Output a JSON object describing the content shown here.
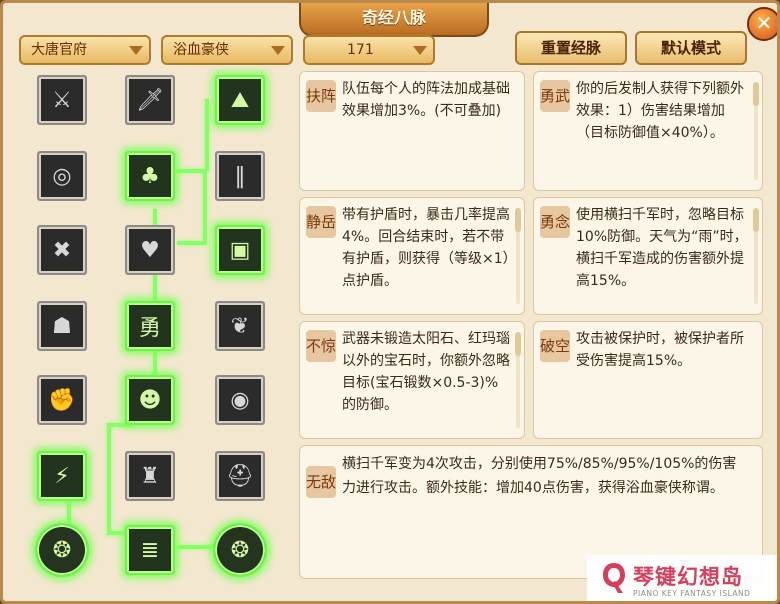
{
  "window": {
    "title": "奇经八脉",
    "close_glyph": "✕"
  },
  "toolbar": {
    "dropdown_sect": "大唐官府",
    "dropdown_school": "浴血豪侠",
    "dropdown_level": "171",
    "reset_button": "重置经脉",
    "default_button": "默认模式"
  },
  "tree": {
    "nodes": [
      {
        "icon": "tiger-head-icon",
        "glyph": "⚔",
        "active": false
      },
      {
        "icon": "sword-strike-icon",
        "glyph": "🗡",
        "active": false
      },
      {
        "icon": "mountain-icon",
        "glyph": "⛰",
        "active": true
      },
      {
        "icon": "spiral-shield-icon",
        "glyph": "◎",
        "active": false
      },
      {
        "icon": "tree-figure-icon",
        "glyph": "♣",
        "active": true
      },
      {
        "icon": "spear-rack-icon",
        "glyph": "‖",
        "active": false
      },
      {
        "icon": "crossed-weapons-icon",
        "glyph": "✖",
        "active": false
      },
      {
        "icon": "heart-shield-icon",
        "glyph": "♥",
        "active": false
      },
      {
        "icon": "fortress-icon",
        "glyph": "▣",
        "active": true
      },
      {
        "icon": "beetle-badge-icon",
        "glyph": "☗",
        "active": false
      },
      {
        "icon": "brave-emblem-icon",
        "glyph": "勇",
        "active": true
      },
      {
        "icon": "feather-leaf-icon",
        "glyph": "❦",
        "active": false
      },
      {
        "icon": "raised-fist-icon",
        "glyph": "✊",
        "active": false
      },
      {
        "icon": "shouting-warrior-icon",
        "glyph": "☻",
        "active": true
      },
      {
        "icon": "eye-sigil-icon",
        "glyph": "◉",
        "active": false
      },
      {
        "icon": "lightning-warrior-icon",
        "glyph": "⚡",
        "active": true
      },
      {
        "icon": "armored-general-icon",
        "glyph": "♜",
        "active": false
      },
      {
        "icon": "helmet-icon",
        "glyph": "⛑",
        "active": false
      },
      {
        "icon": "swirl-orb-left-icon",
        "glyph": "❂",
        "active": true
      },
      {
        "icon": "stacked-blades-icon",
        "glyph": "≣",
        "active": true
      },
      {
        "icon": "swirl-orb-right-icon",
        "glyph": "❂",
        "active": true
      }
    ]
  },
  "cards": [
    {
      "tag": "扶阵",
      "text": "队伍每个人的阵法加成基础效果增加3%。(不可叠加)"
    },
    {
      "tag": "勇武",
      "text": "你的后发制人获得下列额外效果：1）伤害结果增加（目标防御值×40%）。"
    },
    {
      "tag": "静岳",
      "text": "带有护盾时，暴击几率提高4%。回合结束时，若不带有护盾，则获得（等级×1）点护盾。"
    },
    {
      "tag": "勇念",
      "text": "使用横扫千军时，忽略目标10%防御。天气为“雨”时，横扫千军造成的伤害额外提高15%。"
    },
    {
      "tag": "不惊",
      "text": "武器未锻造太阳石、红玛瑙以外的宝石时，你额外忽略目标(宝石锻数×0.5-3)%的防御。"
    },
    {
      "tag": "破空",
      "text": "攻击被保护时，被保护者所受伤害提高15%。"
    },
    {
      "tag": "无敌",
      "text": "横扫千军变为4次攻击，分别使用75%/85%/95%/105%的伤害力进行攻击。额外技能：增加40点伤害，获得浴血豪侠称谓。"
    }
  ],
  "watermark": {
    "text": "琴键幻想岛",
    "sub": "PIANO KEY FANTASY ISLAND"
  }
}
